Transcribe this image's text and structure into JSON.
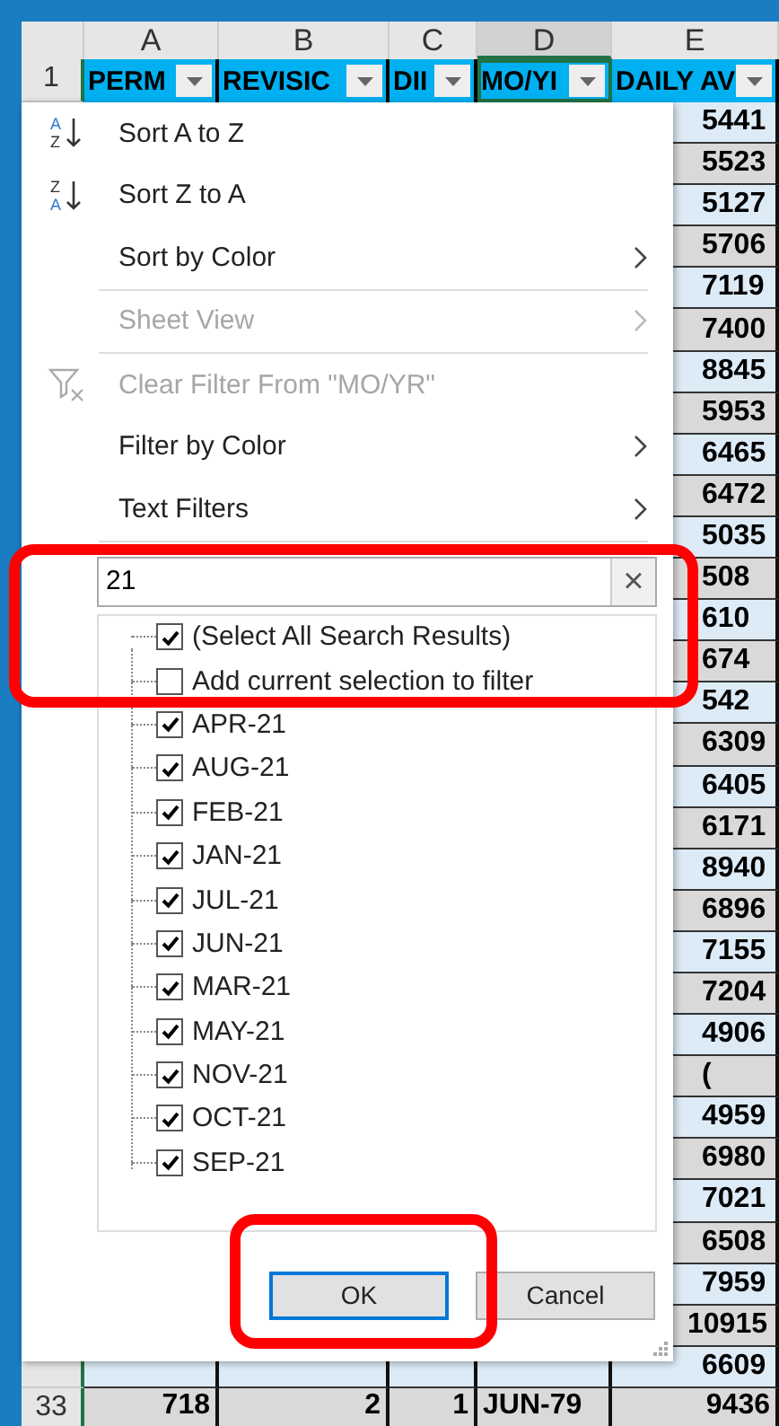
{
  "columns": [
    {
      "letter": "A",
      "selected": false
    },
    {
      "letter": "B",
      "selected": false
    },
    {
      "letter": "C",
      "selected": false
    },
    {
      "letter": "D",
      "selected": true
    },
    {
      "letter": "E",
      "selected": false
    }
  ],
  "header_row": {
    "number": "1",
    "cells": [
      {
        "text": "PERM",
        "selected": false
      },
      {
        "text": "REVISIC",
        "selected": false
      },
      {
        "text": "DII",
        "selected": false
      },
      {
        "text": "MO/YI",
        "selected": true
      },
      {
        "text": "DAILY AV",
        "selected": false
      }
    ]
  },
  "rows": [
    {
      "e": "5441"
    },
    {
      "e": "5523"
    },
    {
      "e": "5127"
    },
    {
      "e": "5706"
    },
    {
      "e": "7119"
    },
    {
      "e": "7400"
    },
    {
      "e": "8845"
    },
    {
      "e": "5953"
    },
    {
      "e": "6465"
    },
    {
      "e": "6472"
    },
    {
      "e": "5035"
    },
    {
      "e": "508"
    },
    {
      "e": "610"
    },
    {
      "e": "674"
    },
    {
      "e": "542"
    },
    {
      "e": "6309"
    },
    {
      "e": "6405"
    },
    {
      "e": "6171"
    },
    {
      "e": "8940"
    },
    {
      "e": "6896"
    },
    {
      "e": "7155"
    },
    {
      "e": "7204"
    },
    {
      "e": "4906"
    },
    {
      "e": "("
    },
    {
      "e": "4959"
    },
    {
      "e": "6980"
    },
    {
      "e": "7021"
    },
    {
      "e": "6508"
    },
    {
      "e": "7959"
    },
    {
      "e": "10915"
    },
    {
      "e": "6609"
    }
  ],
  "last_row": {
    "number": "33",
    "cells": [
      "718",
      "2",
      "1",
      "JUN-79",
      "9436"
    ]
  },
  "menu": {
    "items": [
      {
        "kind": "sort-asc",
        "icon_letters": [
          "A",
          "Z"
        ],
        "label": "Sort A to Z",
        "disabled": false,
        "submenu": false
      },
      {
        "kind": "sort-desc",
        "icon_letters": [
          "Z",
          "A"
        ],
        "label": "Sort Z to A",
        "disabled": false,
        "submenu": false
      },
      {
        "kind": "plain",
        "label": "Sort by Color",
        "disabled": false,
        "submenu": true
      },
      {
        "kind": "plain",
        "label": "Sheet View",
        "disabled": true,
        "submenu": true
      },
      {
        "kind": "clear",
        "label": "Clear Filter From \"MO/YR\"",
        "disabled": true,
        "submenu": false
      },
      {
        "kind": "plain",
        "label": "Filter by Color",
        "disabled": false,
        "submenu": true
      },
      {
        "kind": "plain",
        "label": "Text Filters",
        "disabled": false,
        "submenu": true
      }
    ],
    "search": {
      "value": "21",
      "clear": "×"
    },
    "list": [
      {
        "label": "(Select All Search Results)",
        "checked": true
      },
      {
        "label": "Add current selection to filter",
        "checked": false
      },
      {
        "label": "APR-21",
        "checked": true
      },
      {
        "label": "AUG-21",
        "checked": true
      },
      {
        "label": "FEB-21",
        "checked": true
      },
      {
        "label": "JAN-21",
        "checked": true
      },
      {
        "label": "JUL-21",
        "checked": true
      },
      {
        "label": "JUN-21",
        "checked": true
      },
      {
        "label": "MAR-21",
        "checked": true
      },
      {
        "label": "MAY-21",
        "checked": true
      },
      {
        "label": "NOV-21",
        "checked": true
      },
      {
        "label": "OCT-21",
        "checked": true
      },
      {
        "label": "SEP-21",
        "checked": true
      }
    ],
    "buttons": [
      {
        "label": "OK",
        "default": true
      },
      {
        "label": "Cancel",
        "default": false
      }
    ]
  }
}
